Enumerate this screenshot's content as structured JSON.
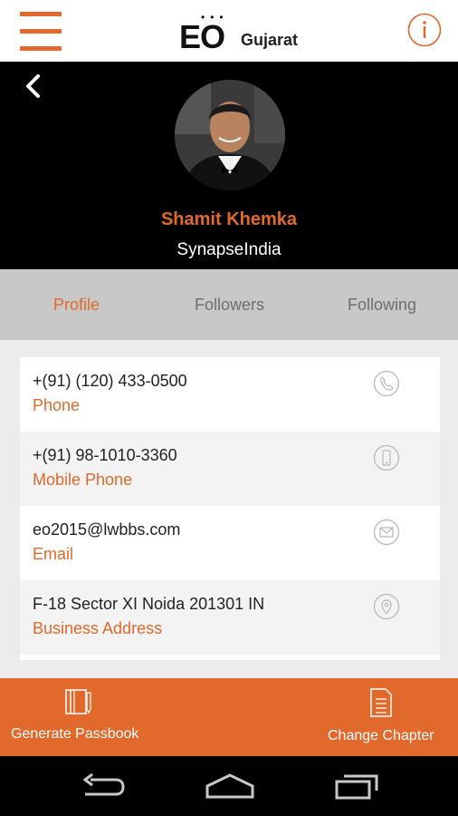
{
  "app": {
    "logo_text": "EO",
    "chapter": "Gujarat"
  },
  "profile": {
    "name": "Shamit Khemka",
    "company": "SynapseIndia"
  },
  "tabs": [
    {
      "label": "Profile",
      "active": true
    },
    {
      "label": "Followers",
      "active": false
    },
    {
      "label": "Following",
      "active": false
    }
  ],
  "contacts": [
    {
      "value": "+(91) (120) 433-0500",
      "label": "Phone",
      "icon": "phone-icon"
    },
    {
      "value": "+(91) 98-1010-3360",
      "label": "Mobile Phone",
      "icon": "mobile-phone-icon"
    },
    {
      "value": "eo2015@lwbbs.com",
      "label": "Email",
      "icon": "email-icon"
    },
    {
      "value": "F-18 Sector XI Noida 201301 IN",
      "label": "Business Address",
      "icon": "location-pin-icon"
    }
  ],
  "footer": {
    "generate_passbook": "Generate Passbook",
    "change_chapter": "Change Chapter"
  },
  "colors": {
    "accent": "#e2692c",
    "header_bg": "#000000",
    "tab_bg": "#c8c8c8"
  }
}
